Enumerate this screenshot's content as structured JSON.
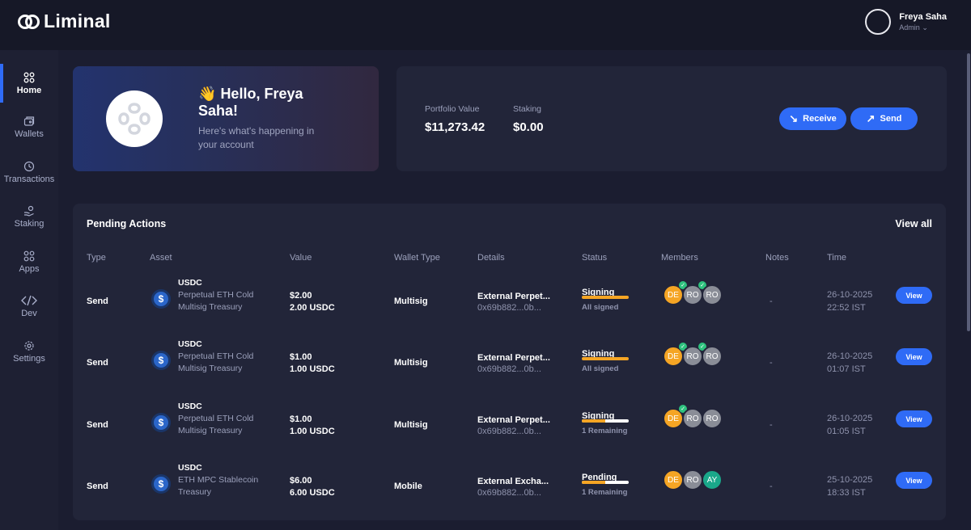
{
  "brand": {
    "name": "Liminal"
  },
  "user": {
    "name": "Freya Saha",
    "role": "Admin"
  },
  "nav": [
    {
      "label": "Home",
      "icon": "home-grid-icon",
      "active": true
    },
    {
      "label": "Wallets",
      "icon": "wallet-icon"
    },
    {
      "label": "Transactions",
      "icon": "clock-icon"
    },
    {
      "label": "Staking",
      "icon": "staking-icon"
    },
    {
      "label": "Apps",
      "icon": "apps-icon"
    },
    {
      "label": "Dev",
      "icon": "code-icon"
    },
    {
      "label": "Settings",
      "icon": "gear-icon"
    }
  ],
  "hello": {
    "wave": "👋",
    "greeting": "Hello, Freya Saha!",
    "subtitle": "Here's what's happening in your account"
  },
  "portfolio": {
    "value_label": "Portfolio Value",
    "value": "$11,273.42",
    "staking_label": "Staking",
    "staking_value": "$0.00",
    "receive_label": "Receive",
    "send_label": "Send"
  },
  "pending": {
    "title": "Pending Actions",
    "view_all": "View all",
    "columns": [
      "Type",
      "Asset",
      "Value",
      "Wallet Type",
      "Details",
      "Status",
      "Members",
      "Notes",
      "Time"
    ],
    "rows": [
      {
        "type": "Send",
        "asset": "USDC",
        "wallet": "Perpetual ETH Cold Multisig Treasury",
        "value": "$2.00",
        "amount": "2.00 USDC",
        "wallet_type": "Multisig",
        "details": "External Perpet...",
        "address": "0x69b882...0b...",
        "status": "Signing",
        "status_sub": "All signed",
        "progress": 1.0,
        "members": [
          {
            "initials": "DE",
            "color": "#f5a524",
            "signed": true
          },
          {
            "initials": "RO",
            "color": "#8a8d97",
            "signed": true
          },
          {
            "initials": "RO",
            "color": "#8a8d97",
            "signed": false
          }
        ],
        "notes": "-",
        "date": "26-10-2025",
        "time": "22:52 IST",
        "view": "View"
      },
      {
        "type": "Send",
        "asset": "USDC",
        "wallet": "Perpetual ETH Cold Multisig Treasury",
        "value": "$1.00",
        "amount": "1.00 USDC",
        "wallet_type": "Multisig",
        "details": "External Perpet...",
        "address": "0x69b882...0b...",
        "status": "Signing",
        "status_sub": "All signed",
        "progress": 1.0,
        "members": [
          {
            "initials": "DE",
            "color": "#f5a524",
            "signed": true
          },
          {
            "initials": "RO",
            "color": "#8a8d97",
            "signed": true
          },
          {
            "initials": "RO",
            "color": "#8a8d97",
            "signed": false
          }
        ],
        "notes": "-",
        "date": "26-10-2025",
        "time": "01:07 IST",
        "view": "View"
      },
      {
        "type": "Send",
        "asset": "USDC",
        "wallet": "Perpetual ETH Cold Multisig Treasury",
        "value": "$1.00",
        "amount": "1.00 USDC",
        "wallet_type": "Multisig",
        "details": "External Perpet...",
        "address": "0x69b882...0b...",
        "status": "Signing",
        "status_sub": "1 Remaining",
        "progress": 0.5,
        "members": [
          {
            "initials": "DE",
            "color": "#f5a524",
            "signed": true
          },
          {
            "initials": "RO",
            "color": "#8a8d97",
            "signed": false
          },
          {
            "initials": "RO",
            "color": "#8a8d97",
            "signed": false
          }
        ],
        "notes": "-",
        "date": "26-10-2025",
        "time": "01:05 IST",
        "view": "View"
      },
      {
        "type": "Send",
        "asset": "USDC",
        "wallet": "ETH MPC Stablecoin Treasury",
        "value": "$6.00",
        "amount": "6.00 USDC",
        "wallet_type": "Mobile",
        "details": "External Excha...",
        "address": "0x69b882...0b...",
        "status": "Pending",
        "status_sub": "1 Remaining",
        "progress": 0.5,
        "members": [
          {
            "initials": "DE",
            "color": "#f5a524",
            "signed": false
          },
          {
            "initials": "RO",
            "color": "#8a8d97",
            "signed": false
          },
          {
            "initials": "AY",
            "color": "#1aa88a",
            "signed": false
          }
        ],
        "notes": "-",
        "date": "25-10-2025",
        "time": "18:33 IST",
        "view": "View"
      }
    ]
  }
}
